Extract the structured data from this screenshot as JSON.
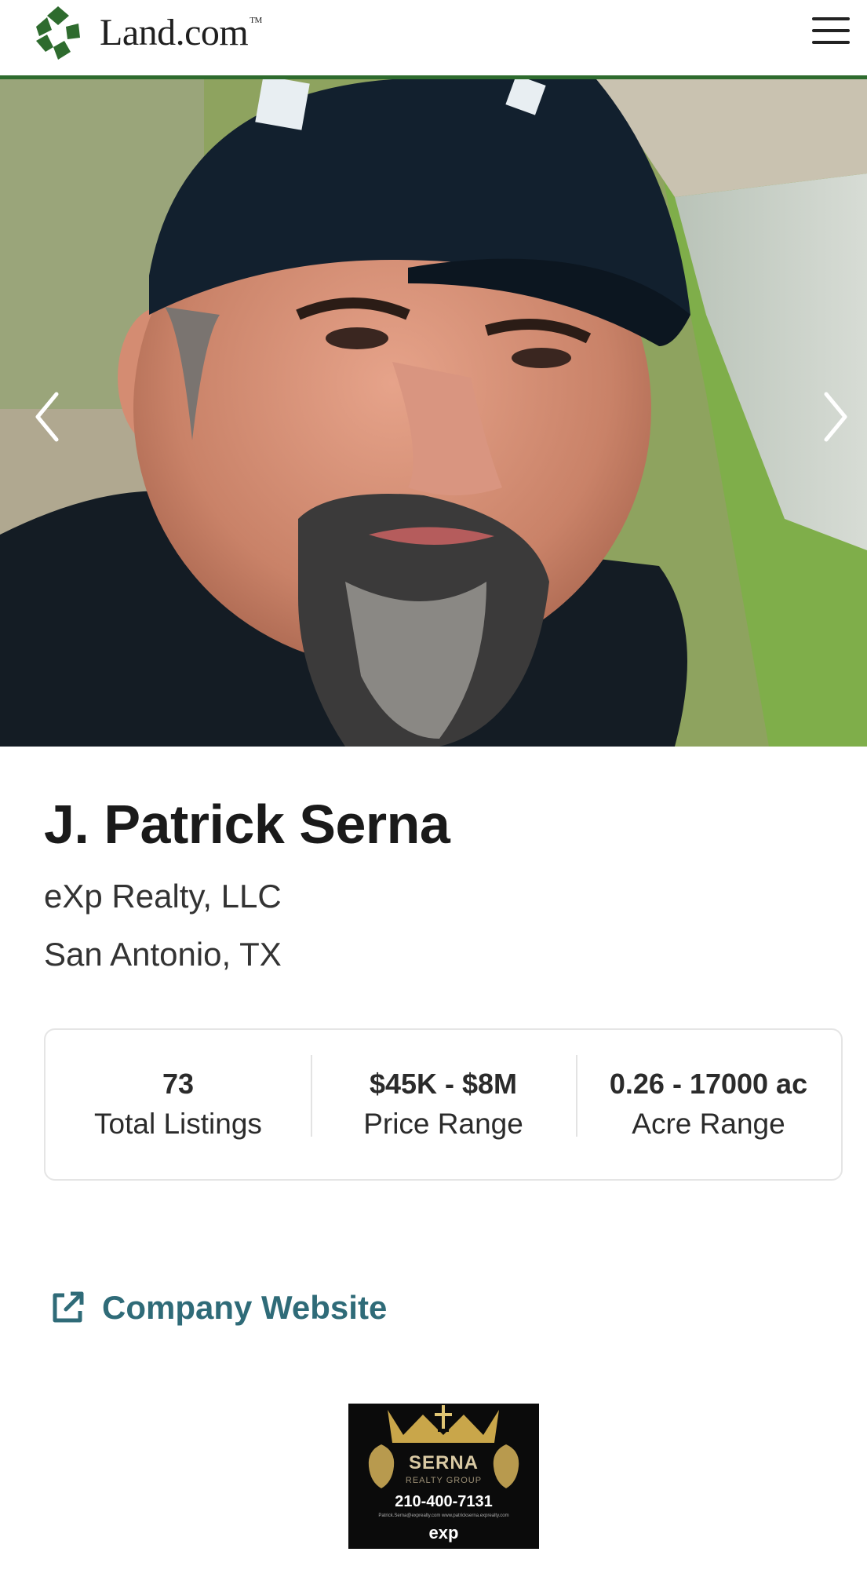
{
  "header": {
    "brand": "Land.com",
    "trademark": "TM",
    "menu_icon": "hamburger-menu-icon"
  },
  "hero": {
    "prev_icon": "chevron-left-icon",
    "next_icon": "chevron-right-icon"
  },
  "agent": {
    "name": "J. Patrick Serna",
    "company": "eXp Realty, LLC",
    "location": "San Antonio, TX"
  },
  "stats": [
    {
      "value": "73",
      "label": "Total Listings"
    },
    {
      "value": "$45K - $8M",
      "label": "Price Range"
    },
    {
      "value": "0.26 - 17000 ac",
      "label": "Acre Range"
    }
  ],
  "company_website": {
    "label": "Company Website",
    "icon": "external-link-icon",
    "color": "#2f6b78"
  },
  "brand_card": {
    "name": "SERNA",
    "sub": "REALTY GROUP",
    "phone": "210-400-7131",
    "tiny": "Patrick.Serna@exprealty.com    www.patrickserna.exprealty.com",
    "exp": "exp"
  },
  "colors": {
    "accent_green": "#2e6b2e",
    "link_teal": "#2f6b78"
  }
}
